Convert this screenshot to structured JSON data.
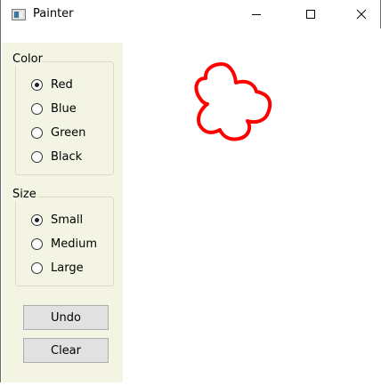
{
  "window": {
    "title": "Painter",
    "controls": {
      "minimize": "minimize-icon",
      "maximize": "maximize-icon",
      "close": "close-icon"
    }
  },
  "color_group": {
    "title": "Color",
    "options": [
      {
        "label": "Red",
        "checked": true
      },
      {
        "label": "Blue",
        "checked": false
      },
      {
        "label": "Green",
        "checked": false
      },
      {
        "label": "Black",
        "checked": false
      }
    ]
  },
  "size_group": {
    "title": "Size",
    "options": [
      {
        "label": "Small",
        "checked": true
      },
      {
        "label": "Medium",
        "checked": false
      },
      {
        "label": "Large",
        "checked": false
      }
    ]
  },
  "buttons": {
    "undo": "Undo",
    "clear": "Clear"
  },
  "canvas": {
    "stroke_color": "#ff0000"
  },
  "colors": {
    "sidebar_bg": "#f4f4e4",
    "button_bg": "#e1e1e1"
  }
}
